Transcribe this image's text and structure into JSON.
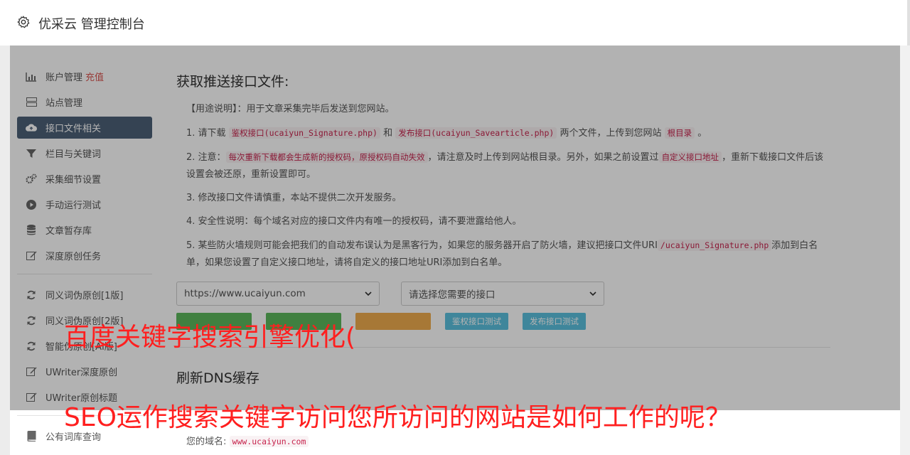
{
  "header": {
    "title": "优采云 管理控制台",
    "icon": "gear-icon"
  },
  "sidebar": {
    "items": [
      {
        "label": "账户管理",
        "extra": "充值",
        "icon": "bar-chart-icon"
      },
      {
        "label": "站点管理",
        "icon": "server-icon"
      },
      {
        "label": "接口文件相关",
        "icon": "cloud-upload-icon",
        "active": true
      },
      {
        "label": "栏目与关键词",
        "icon": "filter-icon"
      },
      {
        "label": "采集细节设置",
        "icon": "cogs-icon"
      },
      {
        "label": "手动运行测试",
        "icon": "play-icon"
      },
      {
        "label": "文章暂存库",
        "icon": "database-icon"
      },
      {
        "label": "深度原创任务",
        "icon": "edit-icon"
      }
    ],
    "group2": [
      {
        "label": "同义词伪原创[1版]",
        "icon": "refresh-icon"
      },
      {
        "label": "同义词伪原创[2版]",
        "icon": "refresh-icon"
      },
      {
        "label": "智能伪原创[AI版]",
        "icon": "refresh-icon"
      },
      {
        "label": "UWriter深度原创",
        "icon": "edit-icon"
      },
      {
        "label": "UWriter原创标题",
        "icon": "edit-icon"
      }
    ],
    "group3": [
      {
        "label": "公有词库查询",
        "icon": "book-icon"
      }
    ]
  },
  "section1": {
    "title": "获取推送接口文件:",
    "usage": "【用途说明】：用于文章采集完毕后发送到您网站。",
    "step1": {
      "prefix": "1. 请下载",
      "code1": "鉴权接口(ucaiyun_Signature.php)",
      "mid": "和",
      "code2": "发布接口(ucaiyun_Savearticle.php)",
      "mid2": "两个文件，上传到您网站",
      "code3": "根目录",
      "end": "。"
    },
    "step2": {
      "prefix": "2. 注意：",
      "code1": "每次重新下载都会生成新的授权码，原授权码自动失效",
      "mid": "，请注意及时上传到网站根目录。另外，如果之前设置过",
      "code2": "自定义接口地址",
      "end": "，重新下载接口文件后该设置会被还原，重新设置即可。"
    },
    "step3": "3. 修改接口文件请慎重，本站不提供二次开发服务。",
    "step4": "4. 安全性说明：每个域名对应的接口文件内有唯一的授权码，请不要泄露给他人。",
    "step5": {
      "prefix": "5. 某些防火墙规则可能会把我们的自动发布误认为是黑客行为，如果您的服务器开启了防火墙，建议把接口文件URI",
      "code1": "/ucaiyun_Signature.php",
      "end": "添加到白名单，如果您设置了自定义接口地址，请将自定义的接口地址URI添加到白名单。"
    },
    "site_select": "https://www.ucaiyun.com",
    "api_select": "请选择您需要的接口",
    "buttons": {
      "btn4": "鉴权接口测试",
      "btn5": "发布接口测试"
    }
  },
  "section2": {
    "title": "刷新DNS缓存",
    "domain_label": "您的域名:",
    "domain_value": "www.ucaiyun.com"
  },
  "captions": {
    "line1": "百度关键字搜索引擎优化(",
    "line2": "SEO运作搜索关键字访问您所访问的网站是如何工作的呢？"
  },
  "colors": {
    "active_nav": "#4d6178",
    "btn_green": "#5cb85c",
    "btn_orange": "#f0ad4e",
    "btn_blue": "#5bc0de",
    "caption": "#ff1f1f"
  }
}
